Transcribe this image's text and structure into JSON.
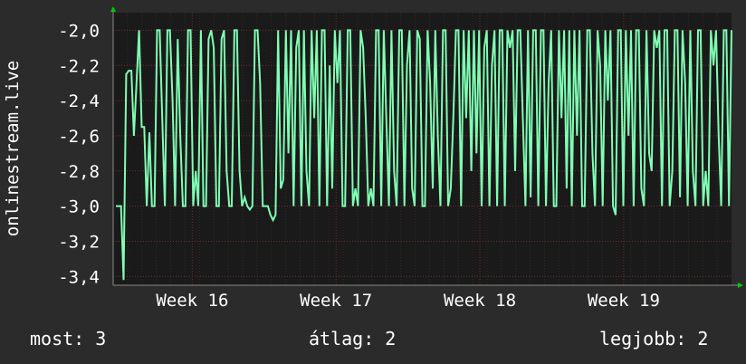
{
  "chart_data": {
    "type": "line",
    "ylabel": "onlinestream.live",
    "ylim": [
      -3.45,
      -1.9
    ],
    "yticks": [
      {
        "value": -2.0,
        "label": "-2,0"
      },
      {
        "value": -2.2,
        "label": "-2,2"
      },
      {
        "value": -2.4,
        "label": "-2,4"
      },
      {
        "value": -2.6,
        "label": "-2,6"
      },
      {
        "value": -2.8,
        "label": "-2,8"
      },
      {
        "value": -3.0,
        "label": "-3,0"
      },
      {
        "value": -3.2,
        "label": "-3,2"
      },
      {
        "value": -3.4,
        "label": "-3,4"
      }
    ],
    "xlim": [
      0,
      4.3
    ],
    "xticks": [
      {
        "value": 0.55,
        "label": "Week 16"
      },
      {
        "value": 1.55,
        "label": "Week 17"
      },
      {
        "value": 2.55,
        "label": "Week 18"
      },
      {
        "value": 3.55,
        "label": "Week 19"
      }
    ],
    "grid": true,
    "colors": {
      "background": "#2b2b2b",
      "plot_background": "#1a1a1a",
      "grid": "#7a2a2a",
      "line": "#7fffb4",
      "axis_arrow": "#00cc00"
    },
    "series": [
      {
        "values": [
          -3.0,
          -3.0,
          -3.0,
          -3.42,
          -2.25,
          -2.23,
          -2.23,
          -2.6,
          -2.3,
          -2.0,
          -2.55,
          -2.55,
          -3.0,
          -2.58,
          -3.0,
          -3.0,
          -2.0,
          -2.0,
          -2.5,
          -3.0,
          -2.0,
          -2.0,
          -2.4,
          -3.0,
          -2.05,
          -2.6,
          -3.0,
          -3.0,
          -2.0,
          -2.0,
          -3.0,
          -2.8,
          -3.0,
          -2.0,
          -3.0,
          -3.0,
          -2.05,
          -2.0,
          -2.1,
          -3.0,
          -3.0,
          -2.05,
          -2.0,
          -2.8,
          -3.0,
          -3.0,
          -2.0,
          -2.0,
          -2.8,
          -3.0,
          -2.95,
          -3.0,
          -3.02,
          -3.0,
          -2.0,
          -2.0,
          -2.3,
          -3.0,
          -3.0,
          -3.0,
          -3.05,
          -3.08,
          -3.05,
          -2.0,
          -2.9,
          -2.85,
          -2.0,
          -2.7,
          -2.0,
          -3.0,
          -2.1,
          -2.0,
          -3.0,
          -2.0,
          -2.8,
          -3.0,
          -2.0,
          -2.5,
          -2.0,
          -3.0,
          -2.0,
          -2.0,
          -3.0,
          -2.2,
          -2.9,
          -2.0,
          -2.3,
          -2.0,
          -3.0,
          -3.0,
          -2.0,
          -2.0,
          -3.0,
          -2.9,
          -3.0,
          -2.0,
          -2.1,
          -2.5,
          -3.0,
          -2.9,
          -3.0,
          -2.0,
          -2.0,
          -3.0,
          -2.0,
          -2.5,
          -3.0,
          -2.0,
          -2.8,
          -3.0,
          -2.0,
          -2.0,
          -3.0,
          -2.2,
          -2.0,
          -2.9,
          -3.0,
          -2.0,
          -2.05,
          -3.0,
          -3.0,
          -2.0,
          -2.3,
          -2.9,
          -2.0,
          -2.6,
          -3.0,
          -2.0,
          -2.0,
          -3.0,
          -2.9,
          -2.5,
          -2.0,
          -2.0,
          -3.0,
          -2.0,
          -2.5,
          -2.0,
          -2.8,
          -2.0,
          -2.7,
          -2.0,
          -3.0,
          -2.1,
          -2.0,
          -3.0,
          -2.2,
          -2.0,
          -3.0,
          -2.0,
          -2.0,
          -3.0,
          -2.0,
          -2.1,
          -2.0,
          -2.8,
          -2.0,
          -2.0,
          -2.5,
          -3.0,
          -2.0,
          -2.95,
          -2.0,
          -2.0,
          -3.0,
          -2.0,
          -2.0,
          -3.0,
          -2.3,
          -2.0,
          -3.0,
          -3.0,
          -2.0,
          -2.5,
          -2.0,
          -2.9,
          -2.0,
          -3.0,
          -2.0,
          -2.6,
          -2.0,
          -3.0,
          -3.0,
          -2.0,
          -2.0,
          -2.7,
          -3.0,
          -2.0,
          -2.2,
          -3.0,
          -2.0,
          -2.4,
          -2.0,
          -3.0,
          -3.05,
          -2.0,
          -2.0,
          -3.0,
          -2.0,
          -2.6,
          -2.0,
          -3.0,
          -2.0,
          -2.0,
          -2.9,
          -3.0,
          -2.0,
          -2.7,
          -2.8,
          -2.0,
          -2.1,
          -2.0,
          -3.0,
          -2.0,
          -2.0,
          -3.0,
          -2.8,
          -2.0,
          -2.0,
          -2.95,
          -2.0,
          -2.3,
          -3.0,
          -2.0,
          -2.8,
          -3.0,
          -2.0,
          -2.0,
          -3.0,
          -2.8,
          -3.0,
          -2.0,
          -2.2,
          -2.0,
          -2.6,
          -3.0,
          -2.0,
          -2.0,
          -3.0,
          -2.0
        ],
        "color": "#7fffb4"
      }
    ]
  },
  "footer": {
    "current": "most: 3",
    "average": "átlag: 2",
    "best": "legjobb: 2"
  }
}
